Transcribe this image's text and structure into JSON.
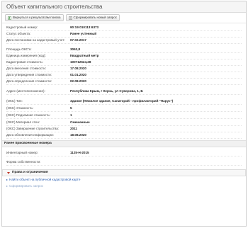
{
  "title": "Объект капитального строительства",
  "toolbar": {
    "back_label": "Вернуться к результатам поиска",
    "request_label": "Сформировать новый запрос"
  },
  "group1": [
    {
      "label": "Кадастровый номер:",
      "value": "90:19:010113:6373"
    },
    {
      "label": "Статус объекта:",
      "value": "Ранее учтенный"
    },
    {
      "label": "Дата постановки на кадастровый учет:",
      "value": "07.02.2017"
    }
  ],
  "group2": [
    {
      "label": "Площадь ОКС'a:",
      "value": "3063,8"
    },
    {
      "label": "Единица измерения (код):",
      "value": "Квадратный метр"
    },
    {
      "label": "Кадастровая стоимость:",
      "value": "100712624,28"
    },
    {
      "label": "Дата внесения стоимости:",
      "value": "17.08.2020"
    },
    {
      "label": "Дата утверждения стоимости:",
      "value": "01.01.2020"
    },
    {
      "label": "Дата определения стоимости:",
      "value": "02.08.2020"
    }
  ],
  "address": {
    "label": "Адрес (местоположение):",
    "value": "Республика Крым, г Керчь, ул Суворова, 1, Б"
  },
  "group3": [
    {
      "label": "(ОКС) Тип:",
      "value": "Здание (Нежилое здание, Санаторий - профилакторий \"Парус\")"
    },
    {
      "label": "(ОКС) Этажность:",
      "value": "5"
    },
    {
      "label": "(ОКС) Подземная этажность:",
      "value": "1"
    },
    {
      "label": "(ОКС) Материал стен:",
      "value": "Смешанные"
    },
    {
      "label": "(ОКС) Завершение строительства:",
      "value": "2011"
    },
    {
      "label": "Дата обновления информации:",
      "value": "18.08.2020"
    }
  ],
  "previous_numbers": {
    "header": "Ранее присвоенные номера",
    "inventory": {
      "label": "Инвентарный номер:",
      "value": "1125-Н-2015"
    }
  },
  "ownership": {
    "label": "Форма собственности:",
    "value": ""
  },
  "rights": {
    "label": "Права и ограничения"
  },
  "links": {
    "map": "Найти объект на публичной кадастровой карте",
    "request": "Сформировать запрос"
  }
}
